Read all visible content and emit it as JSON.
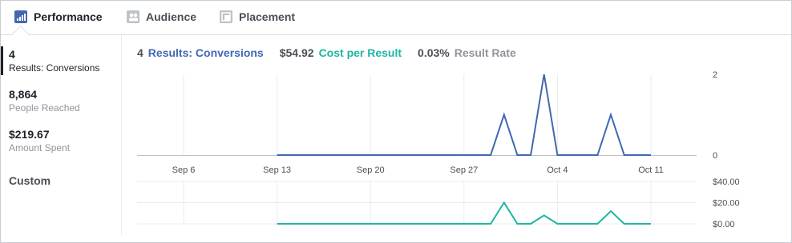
{
  "tabs": [
    {
      "label": "Performance",
      "icon": "bar-chart-icon",
      "active": true
    },
    {
      "label": "Audience",
      "icon": "people-icon",
      "active": false
    },
    {
      "label": "Placement",
      "icon": "placement-icon",
      "active": false
    }
  ],
  "sidebar": {
    "metrics": [
      {
        "value": "4",
        "label": "Results: Conversions",
        "active": true
      },
      {
        "value": "8,864",
        "label": "People Reached",
        "active": false
      },
      {
        "value": "$219.67",
        "label": "Amount Spent",
        "active": false
      }
    ],
    "custom_label": "Custom"
  },
  "summary": {
    "results_value": "4",
    "results_label": "Results: Conversions",
    "cost_value": "$54.92",
    "cost_label": "Cost per Result",
    "rate_value": "0.03%",
    "rate_label": "Result Rate"
  },
  "colors": {
    "results": "#4267b2",
    "cost": "#1fb5a3",
    "rate": "#90949c",
    "grid": "#e9ebee",
    "axis": "#bec3c9"
  },
  "chart_data": [
    {
      "type": "line",
      "title": "",
      "series": [
        {
          "name": "Results: Conversions",
          "x": [
            "Sep 13",
            "Sep 14",
            "Sep 15",
            "Sep 16",
            "Sep 17",
            "Sep 18",
            "Sep 19",
            "Sep 20",
            "Sep 21",
            "Sep 22",
            "Sep 23",
            "Sep 24",
            "Sep 25",
            "Sep 26",
            "Sep 27",
            "Sep 28",
            "Sep 29",
            "Sep 30",
            "Oct 1",
            "Oct 2",
            "Oct 3",
            "Oct 4",
            "Oct 5",
            "Oct 6",
            "Oct 7",
            "Oct 8",
            "Oct 9",
            "Oct 10",
            "Oct 11"
          ],
          "values": [
            0,
            0,
            0,
            0,
            0,
            0,
            0,
            0,
            0,
            0,
            0,
            0,
            0,
            0,
            0,
            0,
            0,
            1,
            0,
            0,
            2,
            0,
            0,
            0,
            0,
            1,
            0,
            0,
            0
          ]
        }
      ],
      "x_ticks": [
        "Sep 6",
        "Sep 13",
        "Sep 20",
        "Sep 27",
        "Oct 4",
        "Oct 11"
      ],
      "y_ticks": [
        "0",
        "2"
      ],
      "ylim": [
        0,
        2
      ],
      "grid": true
    },
    {
      "type": "line",
      "title": "",
      "series": [
        {
          "name": "Cost per Result",
          "x": [
            "Sep 13",
            "Sep 14",
            "Sep 15",
            "Sep 16",
            "Sep 17",
            "Sep 18",
            "Sep 19",
            "Sep 20",
            "Sep 21",
            "Sep 22",
            "Sep 23",
            "Sep 24",
            "Sep 25",
            "Sep 26",
            "Sep 27",
            "Sep 28",
            "Sep 29",
            "Sep 30",
            "Oct 1",
            "Oct 2",
            "Oct 3",
            "Oct 4",
            "Oct 5",
            "Oct 6",
            "Oct 7",
            "Oct 8",
            "Oct 9",
            "Oct 10",
            "Oct 11"
          ],
          "values": [
            0,
            0,
            0,
            0,
            0,
            0,
            0,
            0,
            0,
            0,
            0,
            0,
            0,
            0,
            0,
            0,
            0,
            20,
            0,
            0,
            8,
            0,
            0,
            0,
            0,
            12,
            0,
            0,
            0
          ]
        }
      ],
      "y_ticks": [
        "$0.00",
        "$20.00",
        "$40.00"
      ],
      "ylim": [
        0,
        40
      ],
      "grid": true
    }
  ]
}
